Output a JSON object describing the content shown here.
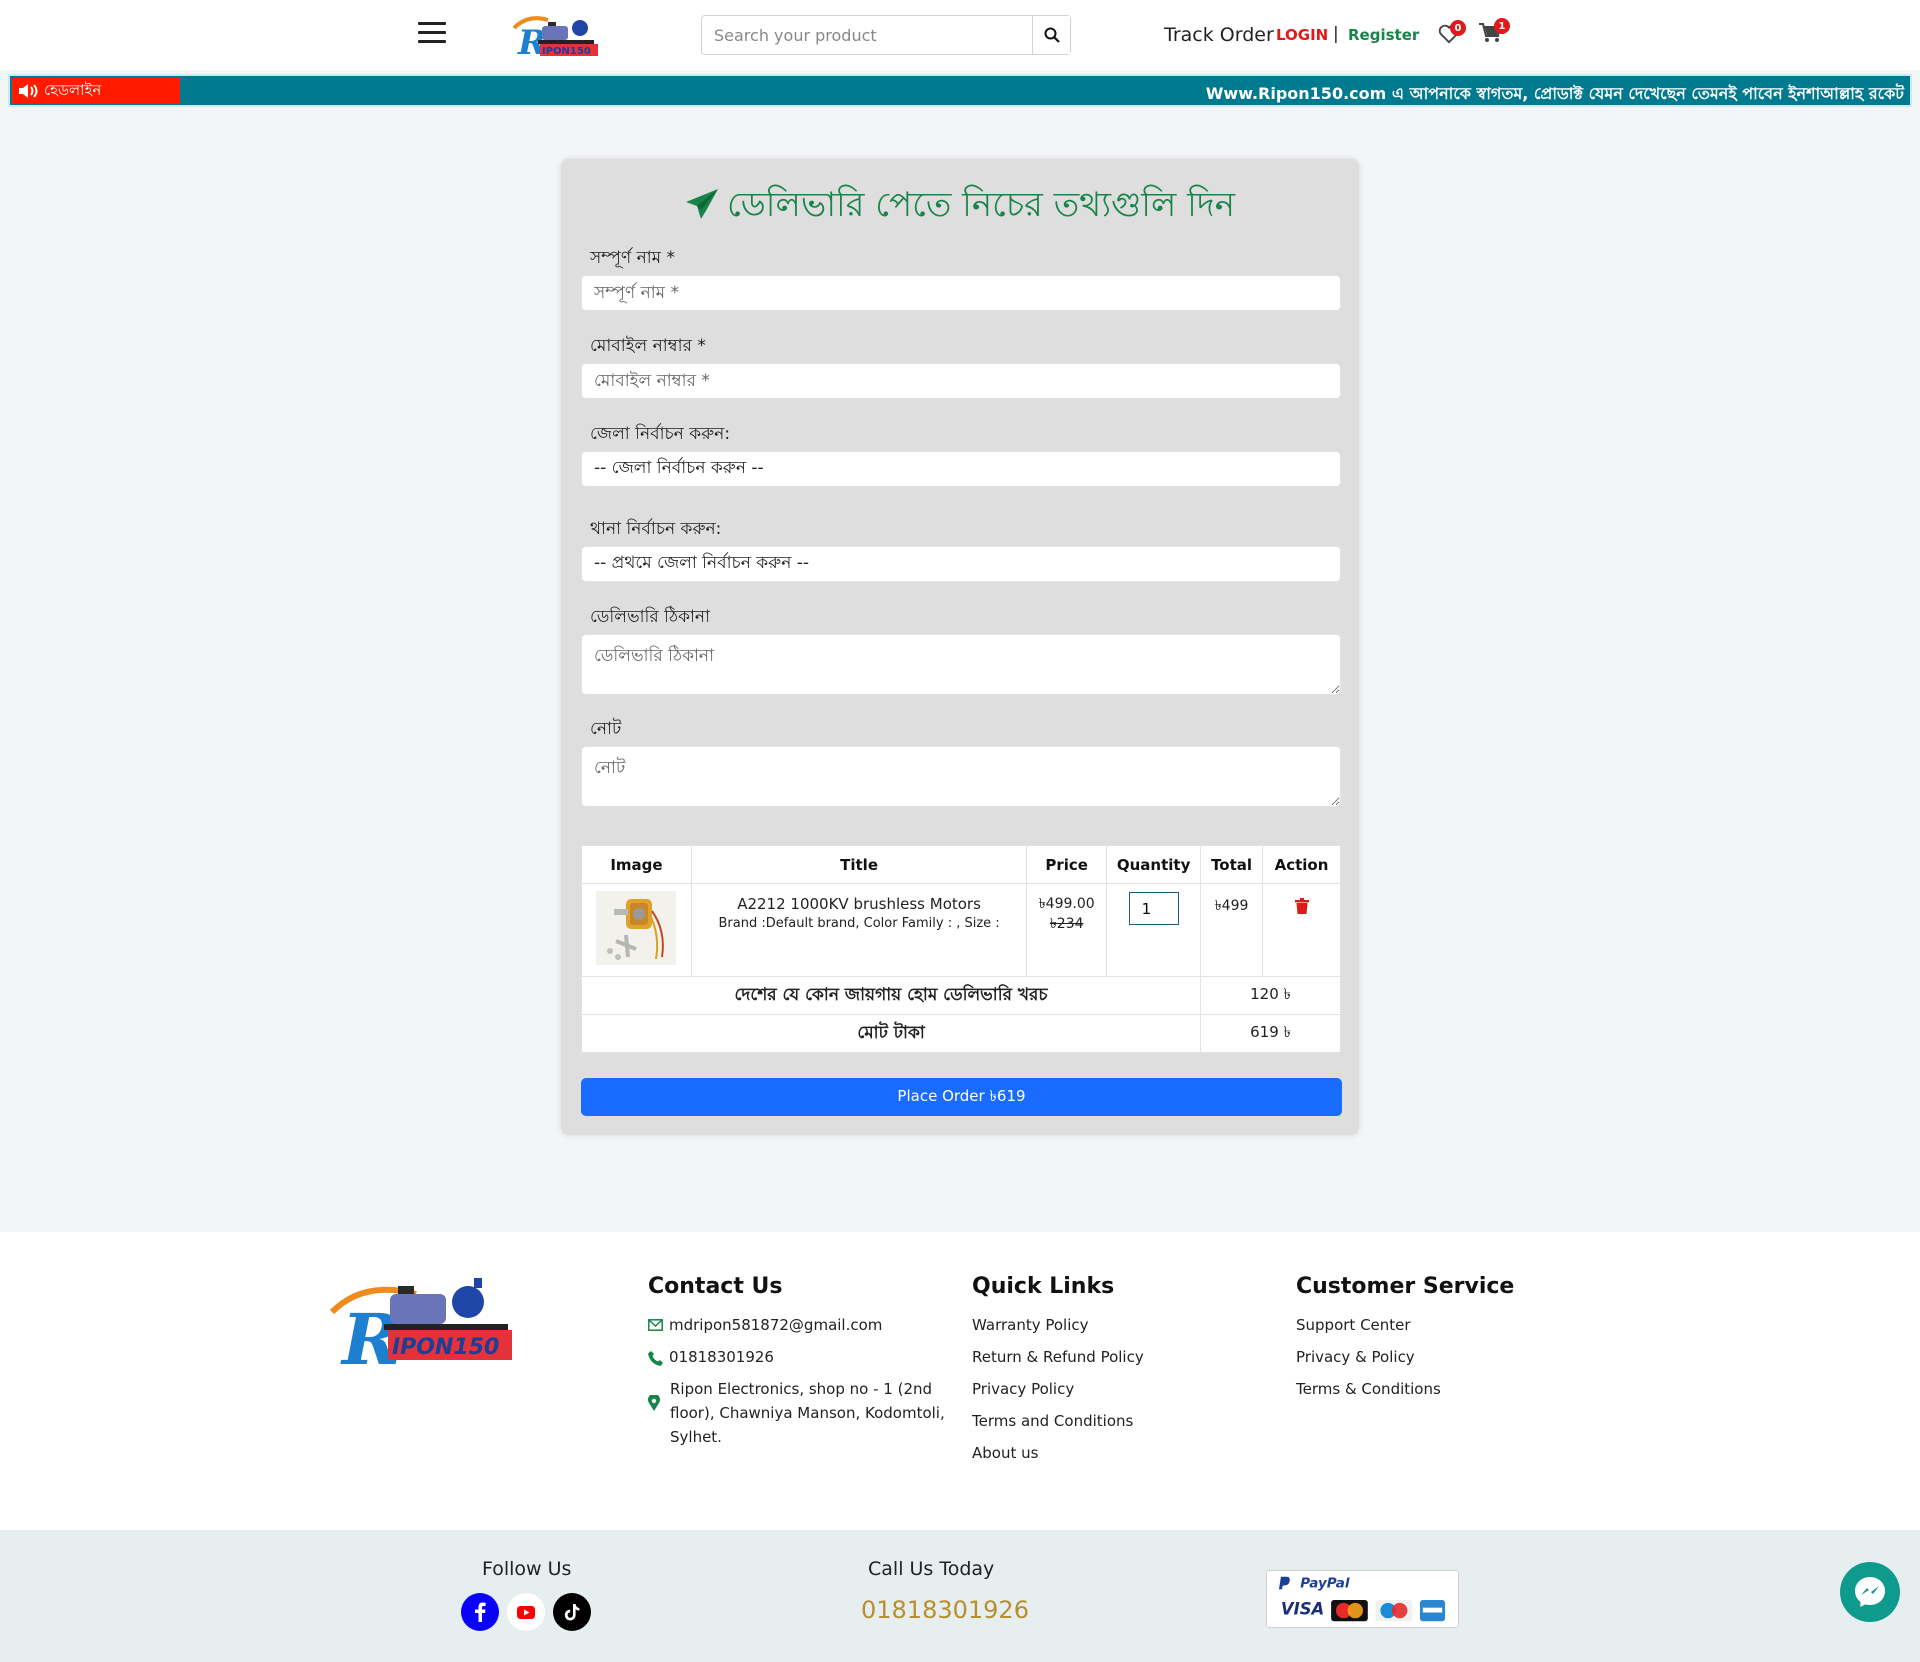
{
  "header": {
    "search_placeholder": "Search your product",
    "track_order": "Track Order",
    "login": "LOGIN",
    "separator": "|",
    "register": "Register",
    "wishlist_count": "0",
    "cart_count": "1"
  },
  "headline": {
    "label": "হেডলাইন",
    "text": "Www.Ripon150.com এ আপনাকে স্বাগতম, প্রোডাক্ট যেমন দেখেছেন তেমনই পাবেন ইনশাআল্লাহ রকেট"
  },
  "form": {
    "title": "ডেলিভারি পেতে নিচের তথ্যগুলি দিন",
    "name_label": "সম্পূর্ণ নাম *",
    "name_placeholder": "সম্পূর্ণ নাম *",
    "mobile_label": "মোবাইল নাম্বার *",
    "mobile_placeholder": "মোবাইল নাম্বার *",
    "district_label": "জেলা নির্বাচন করুন:",
    "district_value": "-- জেলা নির্বাচন করুন --",
    "thana_label": "থানা নির্বাচন করুন:",
    "thana_value": "-- প্রথমে জেলা নির্বাচন করুন --",
    "address_label": "ডেলিভারি ঠিকানা",
    "address_placeholder": "ডেলিভারি ঠিকানা",
    "note_label": "নোট",
    "note_placeholder": "নোট"
  },
  "table": {
    "headers": [
      "Image",
      "Title",
      "Price",
      "Quantity",
      "Total",
      "Action"
    ],
    "rows": [
      {
        "title": "A2212 1000KV brushless Motors",
        "subtitle": "Brand :Default brand, Color Family : , Size :",
        "price": "৳499.00",
        "old_price": "৳234",
        "quantity": "1",
        "total": "৳499"
      }
    ],
    "delivery_label": "দেশের যে কোন জায়গায় হোম ডেলিভারি খরচ",
    "delivery_value": "120 ৳",
    "grand_label": "মোট টাকা",
    "grand_value": "619 ৳"
  },
  "place_order": "Place Order ৳619",
  "footer": {
    "contact_title": "Contact Us",
    "email": "mdripon581872@gmail.com",
    "phone": "01818301926",
    "address": "Ripon Electronics, shop no - 1 (2nd floor), Chawniya Manson, Kodomtoli, Sylhet.",
    "quick_title": "Quick Links",
    "quick_links": [
      "Warranty Policy",
      "Return & Refund Policy",
      "Privacy Policy",
      "Terms and Conditions",
      "About us"
    ],
    "service_title": "Customer Service",
    "service_links": [
      "Support Center",
      "Privacy & Policy",
      "Terms & Conditions"
    ],
    "follow_label": "Follow Us",
    "call_label": "Call Us Today",
    "call_number": "01818301926",
    "logo_text": "IPON150",
    "logo_initial": "R",
    "pay_text": "PayPal",
    "pay_visa": "VISA"
  },
  "colors": {
    "accent_green": "#178549",
    "login_red": "#e01a1a",
    "headline_bar": "#007a8f",
    "headline_label": "#ff1a00",
    "button_blue": "#1a6bff",
    "call_gold": "#b98e2f"
  },
  "icons": [
    "menu-icon",
    "search-icon",
    "heart-icon",
    "cart-icon",
    "speaker-icon",
    "paper-plane-icon",
    "trash-icon",
    "envelope-icon",
    "phone-icon",
    "location-pin-icon",
    "facebook-icon",
    "youtube-icon",
    "tiktok-icon",
    "messenger-icon"
  ]
}
